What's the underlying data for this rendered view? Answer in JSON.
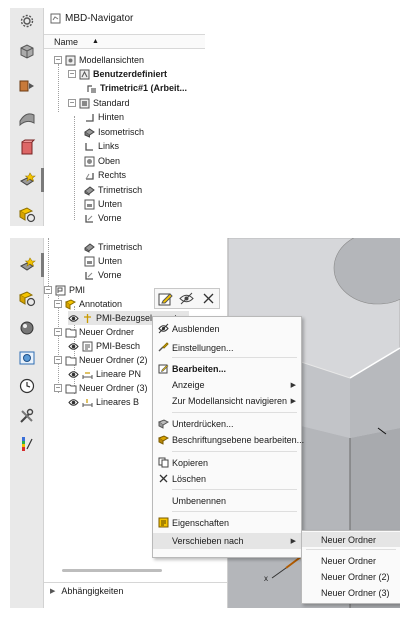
{
  "top": {
    "title": "MBD-Navigator",
    "column_name": "Name",
    "items": [
      {
        "label": "Modellansichten"
      },
      {
        "label": "Benutzerdefiniert"
      },
      {
        "label": "Trimetric#1 (Arbeit..."
      },
      {
        "label": "Standard"
      },
      {
        "label": "Hinten"
      },
      {
        "label": "Isometrisch"
      },
      {
        "label": "Links"
      },
      {
        "label": "Oben"
      },
      {
        "label": "Rechts"
      },
      {
        "label": "Trimetrisch"
      },
      {
        "label": "Unten"
      },
      {
        "label": "Vorne"
      }
    ]
  },
  "bottom": {
    "items": [
      {
        "label": "Trimetrisch"
      },
      {
        "label": "Unten"
      },
      {
        "label": "Vorne"
      },
      {
        "label": "PMI"
      },
      {
        "label": "Annotation"
      },
      {
        "label": "PMI-Bezugselement..."
      },
      {
        "label": "Neuer Ordner"
      },
      {
        "label": "PMI-Besch"
      },
      {
        "label": "Neuer Ordner (2)"
      },
      {
        "label": "Lineare PN"
      },
      {
        "label": "Neuer Ordner (3)"
      },
      {
        "label": "Lineares B"
      }
    ],
    "dependencies_label": "Abhängigkeiten"
  },
  "context_menu": {
    "items": [
      {
        "label": "Ausblenden",
        "icon": "eye-slash-icon"
      },
      {
        "label": "Einstellungen...",
        "icon": "settings-icon"
      },
      {
        "label": "Bearbeiten...",
        "icon": "edit-icon"
      },
      {
        "label": "Anzeige",
        "icon": "",
        "submenu": true
      },
      {
        "label": "Zur Modellansicht navigieren",
        "icon": "",
        "submenu": true
      },
      {
        "label": "Unterdrücken...",
        "icon": "suppress-icon"
      },
      {
        "label": "Beschriftungsebene bearbeiten...",
        "icon": "annotation-plane-icon"
      },
      {
        "label": "Kopieren",
        "icon": "copy-icon"
      },
      {
        "label": "Löschen",
        "icon": "delete-icon"
      },
      {
        "label": "Umbenennen",
        "icon": ""
      },
      {
        "label": "Eigenschaften",
        "icon": "properties-icon"
      },
      {
        "label": "Verschieben nach",
        "icon": "",
        "submenu": true
      }
    ]
  },
  "submenu": {
    "items": [
      {
        "label": "Neuer Ordner"
      },
      {
        "label": "Neuer Ordner"
      },
      {
        "label": "Neuer Ordner (2)"
      },
      {
        "label": "Neuer Ordner (3)"
      }
    ]
  },
  "colors": {
    "highlight": "#e5e5e5",
    "viewport": "#d0d2d6",
    "accent": "#f5c400"
  }
}
